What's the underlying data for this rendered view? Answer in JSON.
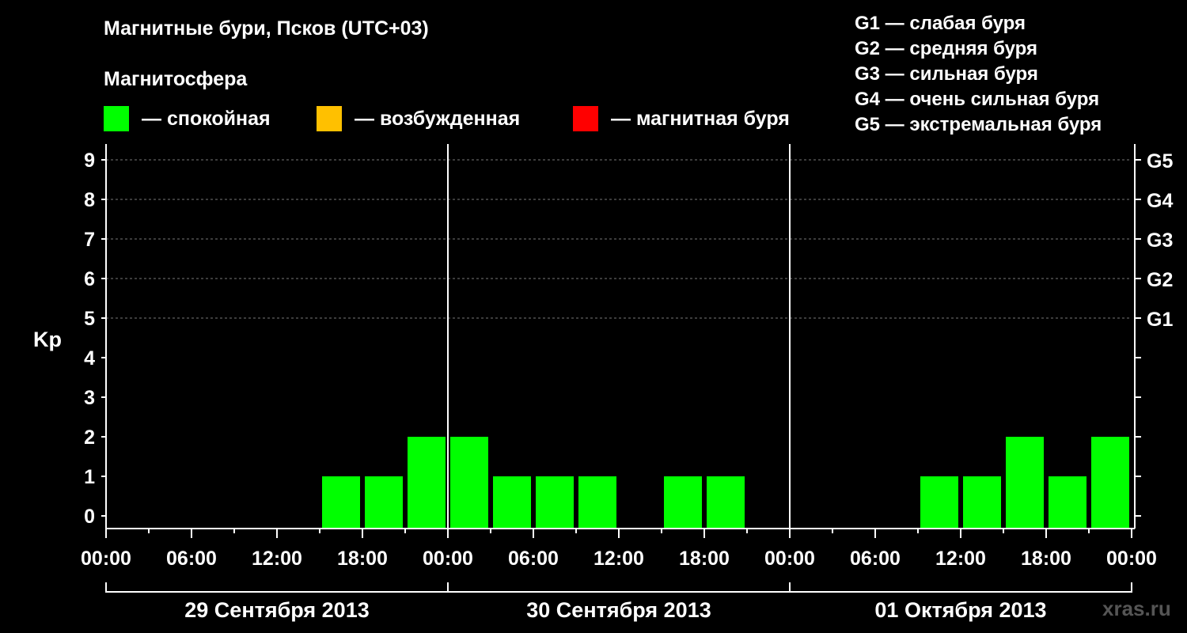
{
  "title": "Магнитные бури, Псков (UTC+03)",
  "legend": {
    "heading": "Магнитосфера",
    "items": [
      {
        "label": "— спокойная",
        "color": "#00ff00"
      },
      {
        "label": "— возбужденная",
        "color": "#ffc000"
      },
      {
        "label": "— магнитная буря",
        "color": "#ff0000"
      }
    ]
  },
  "g_scale": [
    "G1 — слабая буря",
    "G2 — средняя буря",
    "G3 — сильная буря",
    "G4 — очень сильная буря",
    "G5 — экстремальная буря"
  ],
  "watermark": "xras.ru",
  "chart_data": {
    "type": "bar",
    "ylabel": "Kp",
    "ylim": [
      0,
      9
    ],
    "yticks": [
      "0",
      "1",
      "2",
      "3",
      "4",
      "5",
      "6",
      "7",
      "8",
      "9"
    ],
    "right_axis_labels": [
      {
        "kp": 5,
        "label": "G1"
      },
      {
        "kp": 6,
        "label": "G2"
      },
      {
        "kp": 7,
        "label": "G3"
      },
      {
        "kp": 8,
        "label": "G4"
      },
      {
        "kp": 9,
        "label": "G5"
      }
    ],
    "grid": "dashed horizontal at Kp 5-9",
    "xticks": [
      "00:00",
      "06:00",
      "12:00",
      "18:00",
      "00:00",
      "06:00",
      "12:00",
      "18:00",
      "00:00",
      "06:00",
      "12:00",
      "18:00",
      "00:00"
    ],
    "days": [
      "29 Сентября 2013",
      "30 Сентября 2013",
      "01 Октября 2013"
    ],
    "interval_hours": 3,
    "color_quiet": "#00ff00",
    "series": [
      {
        "values": [
          0,
          0,
          0,
          0,
          0,
          1,
          1,
          2,
          2,
          1,
          1,
          1,
          0,
          1,
          1,
          0,
          0,
          0,
          0,
          1,
          1,
          2,
          1,
          2
        ]
      }
    ]
  }
}
